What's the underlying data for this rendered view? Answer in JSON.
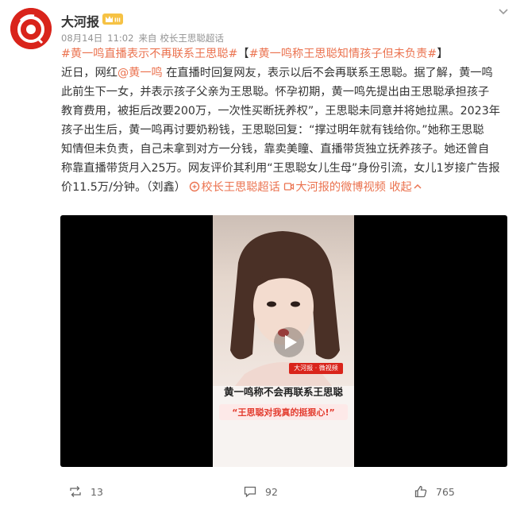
{
  "post": {
    "author": "大河报",
    "level_badge": "III",
    "date": "08月14日",
    "time": "11:02",
    "source_prefix": "来自",
    "source": "校长王思聪超话",
    "lines": [
      "#黄一鸣直播表示不再联系王思聪#【#黄一鸣称王思聪知情孩子但未负责#】",
      "近日，网红",
      "@黄一鸣",
      " 在直播时回复网友，表示以后不会再联系王思聪。据了解，黄一鸣",
      "此前生下一女，并表示孩子父亲为王思聪。怀孕初期，黄一鸣先提出由王思聪承担孩子",
      "教育费用，被拒后改要200万，一次性买断抚养权”，王思聪未同意并将她拉黑。2023年",
      "孩子出生后，黄一鸣再讨要奶粉钱，王思聪回复：“撑过明年就有钱给你。”她称王思聪",
      "知情但未负责，自己未拿到对方一分钱，靠卖美瞳、直播带货独立抚养孩子。她还曾自",
      "称靠直播带货月入25万。网友评价其利用“王思聪女儿生母”身份引流，女儿1岁接广告报",
      "价11.5万/分钟。（刘鑫）"
    ],
    "topic1": "#黄一鸣直播表示不再联系王思聪#",
    "bracket_open": "【",
    "topic2": "#黄一鸣称王思聪知情孩子但未负责#",
    "bracket_close": "】",
    "link_supertopic": "校长王思聪超话",
    "link_video": "大河报的微博视频",
    "collapse": "收起"
  },
  "video": {
    "caption_main": "黄一鸣称不会再联系王思聪",
    "caption_sub": "“王思聪对我真的挺狠心!”",
    "tag": "大河报 · 微视频"
  },
  "actions": {
    "repost_count": "13",
    "comment_count": "92",
    "like_count": "765"
  },
  "colors": {
    "accent": "#eb7350",
    "brand_red": "#d9241b"
  }
}
